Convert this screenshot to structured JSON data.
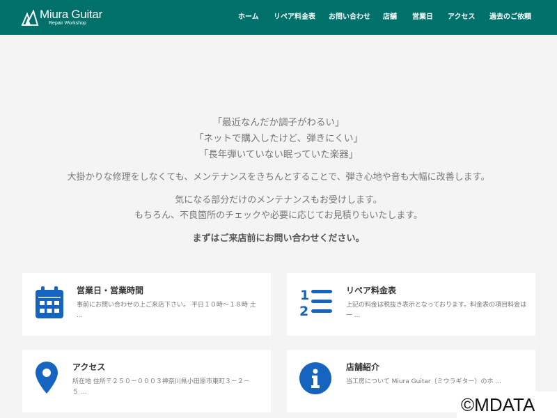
{
  "header": {
    "logo_title": "Miura Guitar",
    "logo_subtitle": "Repair Workshop",
    "nav": [
      "ホーム",
      "リペア料金表",
      "お問い合わせ",
      "店舗",
      "営業日",
      "アクセス",
      "過去のご依頼"
    ]
  },
  "intro": {
    "quotes": [
      "「最近なんだか調子がわるい」",
      "「ネットで購入したけど、弾きにくい」",
      "「長年弾いていない眠っていた楽器」"
    ],
    "paragraph1": "大掛かりな修理をしなくても、メンテナンスをきちんとすることで、弾き心地や音も大幅に改善します。",
    "paragraph2_line1": "気になる部分だけのメンテナンスもお受けします。",
    "paragraph2_line2": "もちろん、不良箇所のチェックや必要に応じてお見積りもいたします。",
    "callout": "まずはご来店前にお問い合わせください。"
  },
  "cards": [
    {
      "title": "営業日・営業時間",
      "desc": "事前にお問い合わせの上ご来店下さい。 平日１０時～１８時 土 ...",
      "icon": "calendar-icon"
    },
    {
      "title": "リペア料金表",
      "desc": "上記の料金は税抜き表示となっております。料金表の項目料金は一 ...",
      "icon": "numbered-list-icon"
    },
    {
      "title": "アクセス",
      "desc": "所在地 住所〒２５０－０００３神奈川県小田原市東町３－２－５ ...",
      "icon": "map-pin-icon"
    },
    {
      "title": "店舗紹介",
      "desc": "当工房について Miura Guitar（ミウラギター）のホ ...",
      "icon": "info-icon"
    }
  ],
  "watermark": "©MDATA",
  "colors": {
    "header": "#00716a",
    "icon_blue": "#1565c0",
    "background": "#f4f4f4"
  }
}
